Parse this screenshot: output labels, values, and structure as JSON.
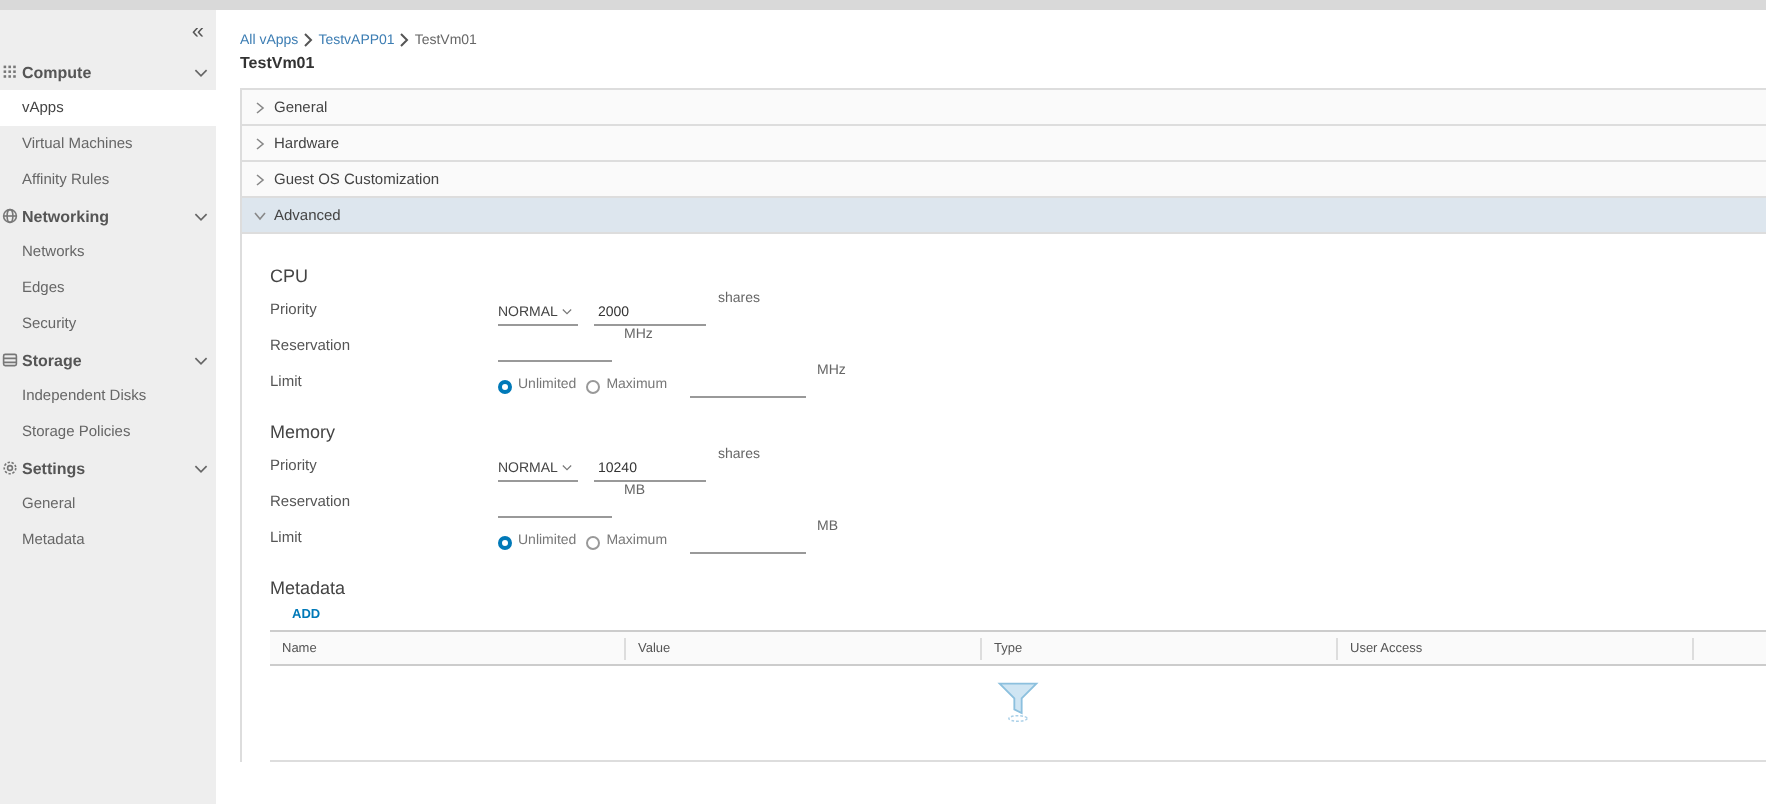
{
  "sidebar": {
    "collapse_icon": "«",
    "sections": [
      {
        "label": "Compute",
        "expanded": true,
        "items": [
          {
            "label": "vApps",
            "selected": true
          },
          {
            "label": "Virtual Machines",
            "selected": false
          },
          {
            "label": "Affinity Rules",
            "selected": false
          }
        ]
      },
      {
        "label": "Networking",
        "expanded": true,
        "items": [
          {
            "label": "Networks",
            "selected": false
          },
          {
            "label": "Edges",
            "selected": false
          },
          {
            "label": "Security",
            "selected": false
          }
        ]
      },
      {
        "label": "Storage",
        "expanded": true,
        "items": [
          {
            "label": "Independent Disks",
            "selected": false
          },
          {
            "label": "Storage Policies",
            "selected": false
          }
        ]
      },
      {
        "label": "Settings",
        "expanded": true,
        "items": [
          {
            "label": "General",
            "selected": false
          },
          {
            "label": "Metadata",
            "selected": false
          }
        ]
      }
    ]
  },
  "breadcrumb": {
    "links": [
      "All vApps",
      "TestvAPP01"
    ],
    "current": "TestVm01"
  },
  "title": "TestVm01",
  "panels": [
    {
      "label": "General",
      "expanded": false
    },
    {
      "label": "Hardware",
      "expanded": false
    },
    {
      "label": "Guest OS Customization",
      "expanded": false
    },
    {
      "label": "Advanced",
      "expanded": true
    }
  ],
  "resources": [
    {
      "title": "CPU",
      "priority_label": "Priority",
      "priority": "NORMAL",
      "shares": "2000",
      "shares_unit": "shares",
      "reservation_label": "Reservation",
      "reservation_unit": "MHz",
      "limit_label": "Limit",
      "limit_options": [
        {
          "label": "Unlimited",
          "selected": true
        },
        {
          "label": "Maximum",
          "selected": false
        }
      ],
      "limit_unit": "MHz"
    },
    {
      "title": "Memory",
      "priority_label": "Priority",
      "priority": "NORMAL",
      "shares": "10240",
      "shares_unit": "shares",
      "reservation_label": "Reservation",
      "reservation_unit": "MB",
      "limit_label": "Limit",
      "limit_options": [
        {
          "label": "Unlimited",
          "selected": true
        },
        {
          "label": "Maximum",
          "selected": false
        }
      ],
      "limit_unit": "MB"
    }
  ],
  "metadata": {
    "title": "Metadata",
    "add": "ADD",
    "columns": [
      "Name",
      "Value",
      "Type",
      "User Access"
    ]
  }
}
